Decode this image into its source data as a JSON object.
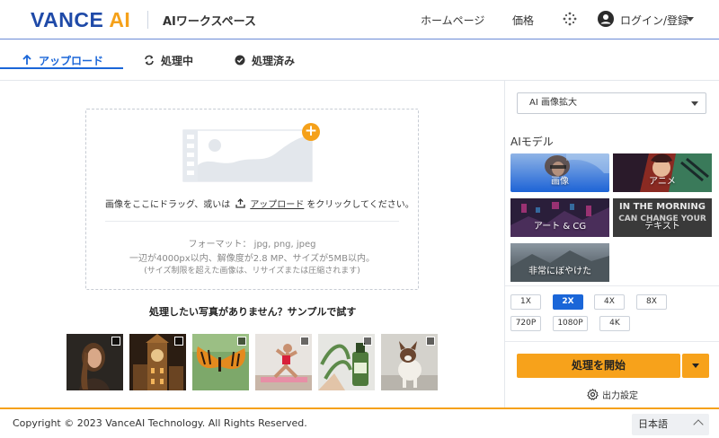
{
  "header": {
    "logo_main": "VANCE",
    "logo_accent": "AI",
    "workspace": "AIワークスペース",
    "nav_home": "ホームページ",
    "nav_price": "価格",
    "login": "ログイン/登録",
    "icons": [
      "apps-grid-icon",
      "user-avatar-icon",
      "chevron-down-icon"
    ]
  },
  "tabs": [
    {
      "label": "アップロード",
      "icon": "upload-arrow-icon",
      "active": true
    },
    {
      "label": "処理中",
      "icon": "refresh-icon",
      "active": false
    },
    {
      "label": "処理済み",
      "icon": "check-circle-icon",
      "active": false
    }
  ],
  "upload": {
    "drop_text_before": "画像をここにドラッグ、或いは",
    "upload_link": "アップロード",
    "drop_text_after": "をクリックしてください。",
    "format_line": "フォーマット： jpg, png, jpeg",
    "limit_line": "一辺が4000px以内、解像度が2.8 MP、サイズが5MB以内。",
    "note_line": "(サイズ制限を超えた画像は、リサイズまたは圧縮されます)"
  },
  "samples": {
    "title": "処理したい写真がありません？サンプルで試す",
    "items": [
      "sample-portrait",
      "sample-clock-tower",
      "sample-butterfly",
      "sample-yoga",
      "sample-plant-bottle",
      "sample-dog"
    ]
  },
  "panel": {
    "mode_select": "AI 画像拡大",
    "model_label": "AIモデル",
    "models": [
      {
        "label": "画像",
        "active": true
      },
      {
        "label": "アニメ",
        "active": false
      },
      {
        "label": "アート & CG",
        "active": false
      },
      {
        "label": "テキスト",
        "active": false
      },
      {
        "label": "非常にぼやけた",
        "active": false
      }
    ],
    "text_tile_overlay": [
      "IN THE MORNING",
      "CAN CHANGE YOUR"
    ],
    "scales": [
      {
        "label": "1X",
        "active": false
      },
      {
        "label": "2X",
        "active": true
      },
      {
        "label": "4X",
        "active": false
      },
      {
        "label": "8X",
        "active": false
      },
      {
        "label": "720P",
        "active": false
      },
      {
        "label": "1080P",
        "active": false
      },
      {
        "label": "4K",
        "active": false
      }
    ],
    "start_button": "処理を開始",
    "output_settings": "出力設定"
  },
  "footer": {
    "copyright": "Copyright © 2023 VanceAI Technology. All Rights Reserved.",
    "language": "日本語"
  },
  "colors": {
    "brand_blue": "#1f4aa8",
    "accent_orange": "#f5a11a",
    "active_blue": "#1a66d8"
  }
}
